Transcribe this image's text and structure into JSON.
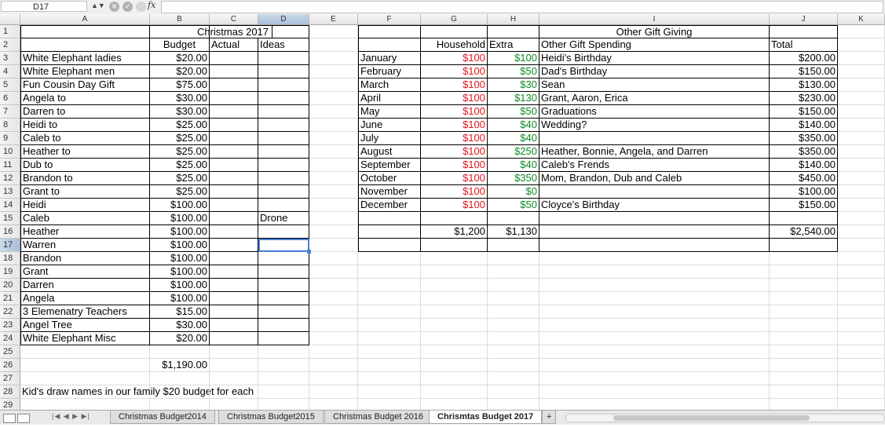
{
  "formula_bar": {
    "name_box": "D17",
    "fx_label": "fx",
    "formula": ""
  },
  "columns": [
    "A",
    "B",
    "C",
    "D",
    "E",
    "F",
    "G",
    "H",
    "I",
    "J",
    "K"
  ],
  "rows": [
    "1",
    "2",
    "3",
    "4",
    "5",
    "6",
    "7",
    "8",
    "9",
    "10",
    "11",
    "12",
    "13",
    "14",
    "15",
    "16",
    "17",
    "18",
    "19",
    "20",
    "21",
    "22",
    "23",
    "24",
    "25",
    "26",
    "27",
    "28",
    "29"
  ],
  "sheet": {
    "title": "Christmas 2017",
    "headers": {
      "budget": "Budget",
      "actual": "Actual",
      "ideas": "Ideas",
      "household": "Household",
      "extra": "Extra",
      "other_spending": "Other Gift Spending",
      "total": "Total"
    },
    "other_title": "Other Gift Giving",
    "gifts": [
      {
        "name": "White Elephant ladies",
        "budget": "$20.00"
      },
      {
        "name": "White Elephant men",
        "budget": "$20.00"
      },
      {
        "name": "Fun Cousin Day Gift",
        "budget": "$75.00"
      },
      {
        "name": "Angela to",
        "budget": "$30.00"
      },
      {
        "name": "Darren to",
        "budget": "$30.00"
      },
      {
        "name": "Heidi to",
        "budget": "$25.00"
      },
      {
        "name": "Caleb to",
        "budget": "$25.00"
      },
      {
        "name": "Heather to",
        "budget": "$25.00"
      },
      {
        "name": "Dub to",
        "budget": "$25.00"
      },
      {
        "name": "Brandon to",
        "budget": "$25.00"
      },
      {
        "name": "Grant to",
        "budget": "$25.00"
      },
      {
        "name": "Heidi",
        "budget": "$100.00"
      },
      {
        "name": "Caleb",
        "budget": "$100.00",
        "idea": "Drone"
      },
      {
        "name": "Heather",
        "budget": "$100.00"
      },
      {
        "name": "Warren",
        "budget": "$100.00"
      },
      {
        "name": "Brandon",
        "budget": "$100.00"
      },
      {
        "name": "Grant",
        "budget": "$100.00"
      },
      {
        "name": "Darren",
        "budget": "$100.00"
      },
      {
        "name": "Angela",
        "budget": "$100.00"
      },
      {
        "name": "3 Elemenatry Teachers",
        "budget": "$15.00"
      },
      {
        "name": "Angel Tree",
        "budget": "$30.00"
      },
      {
        "name": "White Elephant Misc",
        "budget": "$20.00"
      }
    ],
    "budget_total": "$1,190.00",
    "note": "Kid's draw names in our family $20 budget for each",
    "months": [
      {
        "month": "January",
        "household": "$100",
        "extra": "$100",
        "spending": "Heidi's Birthday",
        "total": "$200.00"
      },
      {
        "month": "February",
        "household": "$100",
        "extra": "$50",
        "spending": "Dad's Birthday",
        "total": "$150.00"
      },
      {
        "month": "March",
        "household": "$100",
        "extra": "$30",
        "spending": "Sean",
        "total": "$130.00"
      },
      {
        "month": "April",
        "household": "$100",
        "extra": "$130",
        "spending": "Grant, Aaron, Erica",
        "total": "$230.00"
      },
      {
        "month": "May",
        "household": "$100",
        "extra": "$50",
        "spending": "Graduations",
        "total": "$150.00"
      },
      {
        "month": "June",
        "household": "$100",
        "extra": "$40",
        "spending": "Wedding?",
        "total": "$140.00"
      },
      {
        "month": "July",
        "household": "$100",
        "extra": "$40",
        "spending": "",
        "total": "$350.00"
      },
      {
        "month": "August",
        "household": "$100",
        "extra": "$250",
        "spending": "Heather, Bonnie, Angela, and Darren",
        "total": "$350.00"
      },
      {
        "month": "September",
        "household": "$100",
        "extra": "$40",
        "spending": "Caleb's Frends",
        "total": "$140.00"
      },
      {
        "month": "October",
        "household": "$100",
        "extra": "$350",
        "spending": "Mom, Brandon, Dub and Caleb",
        "total": "$450.00"
      },
      {
        "month": "November",
        "household": "$100",
        "extra": "$0",
        "spending": "",
        "total": "$100.00"
      },
      {
        "month": "December",
        "household": "$100",
        "extra": "$50",
        "spending": "Cloyce's Birthday",
        "total": "$150.00"
      }
    ],
    "household_total": "$1,200",
    "extra_total": "$1,130",
    "grand_total": "$2,540.00"
  },
  "tabs": [
    "Christmas Budget2014",
    "Christmas Budget2015",
    "Christmas Budget 2016",
    "Chrismtas Budget 2017"
  ],
  "active_tab": "Chrismtas Budget 2017",
  "add_tab": "+",
  "colors": {
    "red": "#e0161b",
    "green": "#0d8a23",
    "selection": "#4a7fd6"
  }
}
